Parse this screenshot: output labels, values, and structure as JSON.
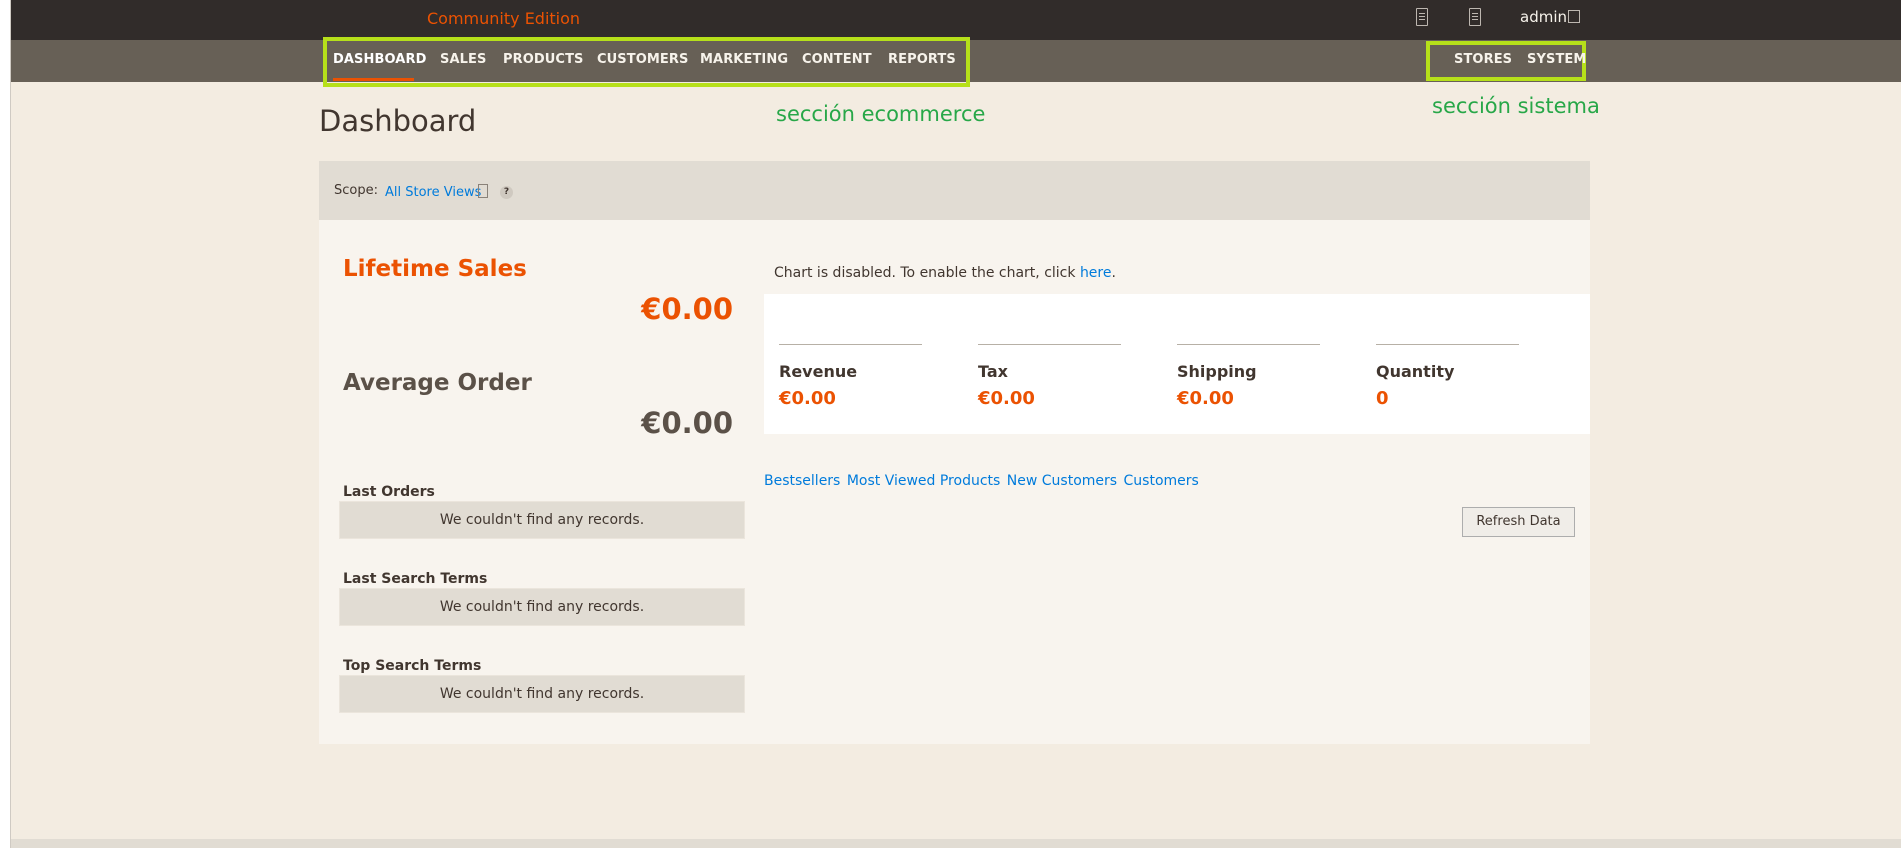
{
  "header": {
    "brand": "Community Edition",
    "user": "admin",
    "icons": [
      "notifications-icon",
      "system-messages-icon",
      "user-icon"
    ]
  },
  "nav": {
    "ecommerce": [
      "DASHBOARD",
      "SALES",
      "PRODUCTS",
      "CUSTOMERS",
      "MARKETING",
      "CONTENT",
      "REPORTS"
    ],
    "system": [
      "STORES",
      "SYSTEM"
    ],
    "active": "DASHBOARD"
  },
  "annotations": {
    "ecommerce": "sección ecommerce",
    "system": "sección sistema"
  },
  "page": {
    "title": "Dashboard"
  },
  "scope": {
    "label": "Scope:",
    "value": "All Store Views",
    "help": "?"
  },
  "sales": {
    "lifetime_label": "Lifetime Sales",
    "lifetime_value": "€0.00",
    "average_label": "Average Order",
    "average_value": "€0.00"
  },
  "sections": [
    {
      "title": "Last Orders",
      "empty": "We couldn't find any records."
    },
    {
      "title": "Last Search Terms",
      "empty": "We couldn't find any records."
    },
    {
      "title": "Top Search Terms",
      "empty": "We couldn't find any records."
    }
  ],
  "chart": {
    "message": "Chart is disabled. To enable the chart, click",
    "link": "here",
    "period": "."
  },
  "totals": [
    {
      "label": "Revenue",
      "value": "€0.00"
    },
    {
      "label": "Tax",
      "value": "€0.00"
    },
    {
      "label": "Shipping",
      "value": "€0.00"
    },
    {
      "label": "Quantity",
      "value": "0"
    }
  ],
  "tabs": [
    "Bestsellers",
    "Most Viewed Products",
    "New Customers",
    "Customers"
  ],
  "refresh_label": "Refresh Data",
  "colors": {
    "accent": "#eb5202",
    "highlight_box": "#b6e01a",
    "annotation": "#27a748",
    "link": "#007bdb"
  }
}
